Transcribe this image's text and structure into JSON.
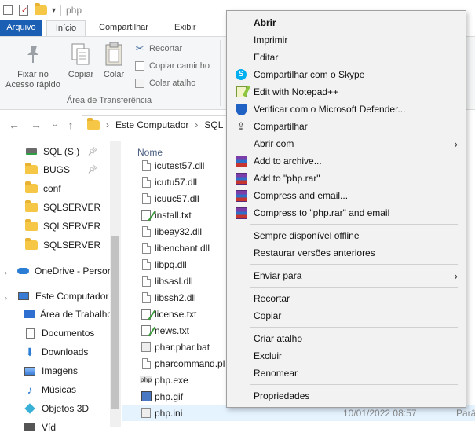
{
  "titlebar": {
    "title": "php"
  },
  "tabs": {
    "file": "Arquivo",
    "home": "Início",
    "share": "Compartilhar",
    "view": "Exibir"
  },
  "ribbon": {
    "pin_line1": "Fixar no",
    "pin_line2": "Acesso rápido",
    "copy": "Copiar",
    "paste": "Colar",
    "cut": "Recortar",
    "copy_path": "Copiar caminho",
    "paste_shortcut": "Colar atalho",
    "group": "Área de Transferência"
  },
  "address": {
    "computer": "Este Computador",
    "drive": "SQL ("
  },
  "sidebar": {
    "items": [
      {
        "label": "SQL (S:)",
        "icon": "drive-icon"
      },
      {
        "label": "BUGS",
        "icon": "folder-icon"
      },
      {
        "label": "conf",
        "icon": "folder-icon"
      },
      {
        "label": "SQLSERVER",
        "icon": "folder-icon"
      },
      {
        "label": "SQLSERVER",
        "icon": "folder-icon"
      },
      {
        "label": "SQLSERVER",
        "icon": "folder-icon"
      },
      {
        "label": "OneDrive - Persor",
        "icon": "cloud-icon"
      },
      {
        "label": "Este Computador",
        "icon": "computer-icon"
      },
      {
        "label": "Área de Trabalho",
        "icon": "desktop-icon"
      },
      {
        "label": "Documentos",
        "icon": "documents-icon"
      },
      {
        "label": "Downloads",
        "icon": "download-icon"
      },
      {
        "label": "Imagens",
        "icon": "pictures-icon"
      },
      {
        "label": "Músicas",
        "icon": "music-icon"
      },
      {
        "label": "Objetos 3D",
        "icon": "objects3d-icon"
      },
      {
        "label": "Víd",
        "icon": "videos-icon"
      }
    ]
  },
  "filelist": {
    "col_name": "Nome",
    "files": [
      {
        "name": "icutest57.dll",
        "icon": "dll-icon"
      },
      {
        "name": "icutu57.dll",
        "icon": "dll-icon"
      },
      {
        "name": "icuuc57.dll",
        "icon": "dll-icon"
      },
      {
        "name": "install.txt",
        "icon": "txt-icon"
      },
      {
        "name": "libeay32.dll",
        "icon": "dll-icon"
      },
      {
        "name": "libenchant.dll",
        "icon": "dll-icon"
      },
      {
        "name": "libpq.dll",
        "icon": "dll-icon"
      },
      {
        "name": "libsasl.dll",
        "icon": "dll-icon"
      },
      {
        "name": "libssh2.dll",
        "icon": "dll-icon"
      },
      {
        "name": "license.txt",
        "icon": "txt-icon"
      },
      {
        "name": "news.txt",
        "icon": "txt-icon"
      },
      {
        "name": "phar.phar.bat",
        "icon": "bat-icon"
      },
      {
        "name": "pharcommand.pl",
        "icon": "file-icon"
      },
      {
        "name": "php.exe",
        "icon": "php-exe-icon"
      },
      {
        "name": "php.gif",
        "icon": "gif-icon"
      },
      {
        "name": "php.ini",
        "icon": "ini-icon",
        "date": "10/01/2022 08:57",
        "type": "Parâ"
      }
    ]
  },
  "context_menu": {
    "items": [
      {
        "label": "Abrir",
        "bold": true
      },
      {
        "label": "Imprimir"
      },
      {
        "label": "Editar"
      },
      {
        "label": "Compartilhar com o Skype",
        "icon": "skype-icon"
      },
      {
        "label": "Edit with Notepad++",
        "icon": "notepadpp-icon"
      },
      {
        "label": "Verificar com o Microsoft Defender...",
        "icon": "defender-icon"
      },
      {
        "label": "Compartilhar",
        "icon": "share-icon"
      },
      {
        "label": "Abrir com",
        "submenu": true
      },
      {
        "label": "Add to archive...",
        "icon": "winrar-icon"
      },
      {
        "label": "Add to \"php.rar\"",
        "icon": "winrar-icon"
      },
      {
        "label": "Compress and email...",
        "icon": "winrar-icon"
      },
      {
        "label": "Compress to \"php.rar\" and email",
        "icon": "winrar-icon"
      },
      {
        "label": "Sempre disponível offline"
      },
      {
        "label": "Restaurar versões anteriores"
      },
      {
        "label": "Enviar para",
        "submenu": true
      },
      {
        "label": "Recortar"
      },
      {
        "label": "Copiar"
      },
      {
        "label": "Criar atalho"
      },
      {
        "label": "Excluir"
      },
      {
        "label": "Renomear"
      },
      {
        "label": "Propriedades"
      }
    ]
  },
  "colors": {
    "accent": "#1a5fb4",
    "selection": "#e5f3ff",
    "menu_bg": "#f2f2f2",
    "folder": "#f6c746"
  }
}
